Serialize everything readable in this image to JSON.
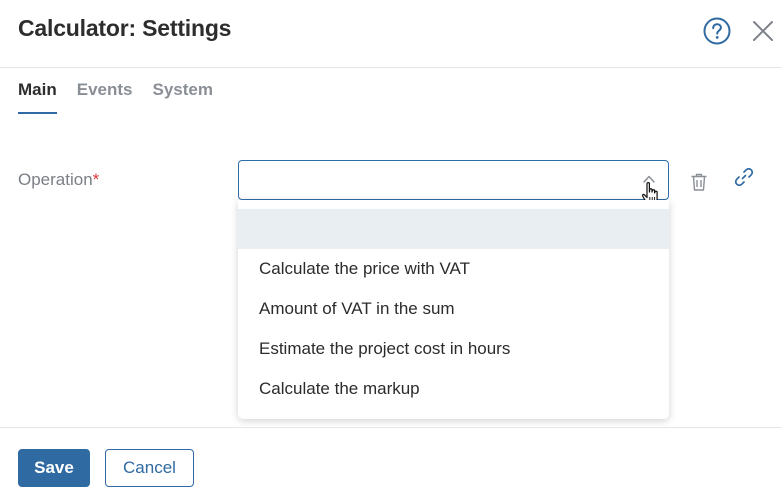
{
  "dialog": {
    "title": "Calculator: Settings"
  },
  "tabs": [
    {
      "label": "Main",
      "active": true
    },
    {
      "label": "Events",
      "active": false
    },
    {
      "label": "System",
      "active": false
    }
  ],
  "form": {
    "operation_label": "Operation",
    "required_marker": "*",
    "operation_value": "",
    "options": [
      "",
      "Calculate the price with VAT",
      "Amount of VAT in the sum",
      "Estimate the project cost in hours",
      "Calculate the markup"
    ]
  },
  "footer": {
    "save_label": "Save",
    "cancel_label": "Cancel"
  },
  "colors": {
    "accent": "#2f6aa2",
    "required": "#d9363e",
    "highlight": "#e9eef3"
  },
  "icons": [
    "help-icon",
    "close-icon",
    "chevron-up-icon",
    "trash-icon",
    "link-icon",
    "hand-cursor-icon"
  ]
}
